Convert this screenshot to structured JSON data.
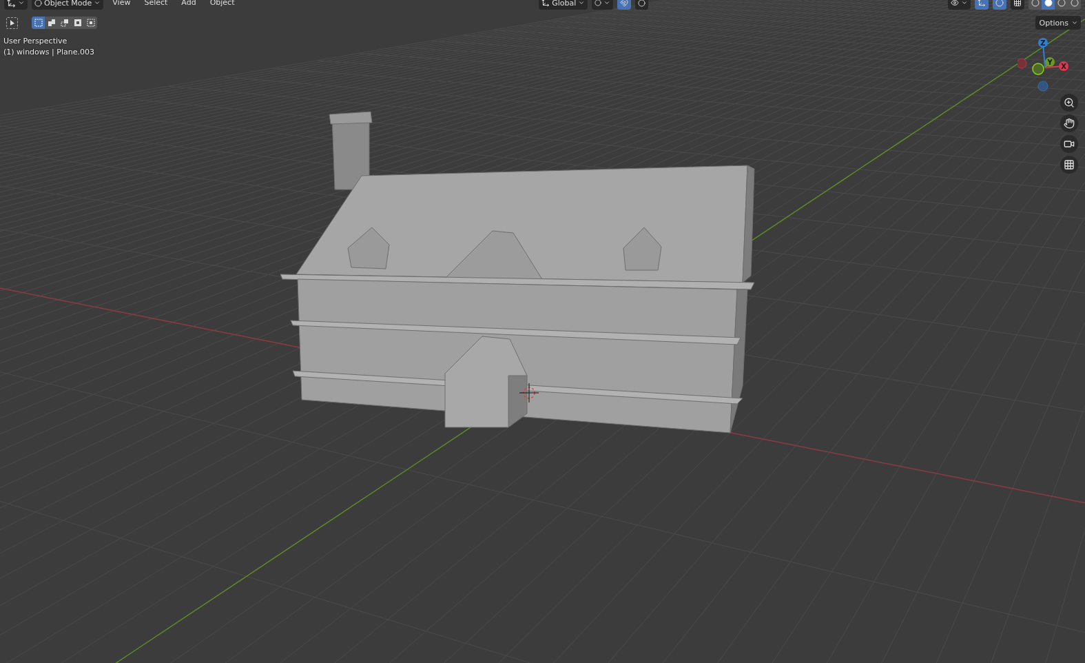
{
  "header": {
    "mode": "Object Mode",
    "menus": [
      "View",
      "Select",
      "Add",
      "Object"
    ],
    "orientation": "Global",
    "snap_on": true,
    "proportional_on": false,
    "overlays_on": true,
    "gizmo_on": true,
    "xray_on": false,
    "shading": [
      {
        "kind": "wireframe",
        "selected": false
      },
      {
        "kind": "solid",
        "selected": true
      },
      {
        "kind": "material",
        "selected": false
      },
      {
        "kind": "rendered",
        "selected": false
      }
    ]
  },
  "select_modes": [
    {
      "kind": "new",
      "selected": true
    },
    {
      "kind": "extend",
      "selected": false
    },
    {
      "kind": "subtract",
      "selected": false
    },
    {
      "kind": "invert",
      "selected": false
    },
    {
      "kind": "intersect",
      "selected": false
    }
  ],
  "options": "Options",
  "viewport": {
    "view_name": "User Perspective",
    "object_info": "(1) windows | Plane.003"
  },
  "gizmo": {
    "axes": [
      {
        "label": "Z",
        "color": "#2f7fd8"
      },
      {
        "label": "Y",
        "color": "#6a9a1f"
      },
      {
        "label": "X",
        "color": "#e0384f"
      }
    ]
  }
}
